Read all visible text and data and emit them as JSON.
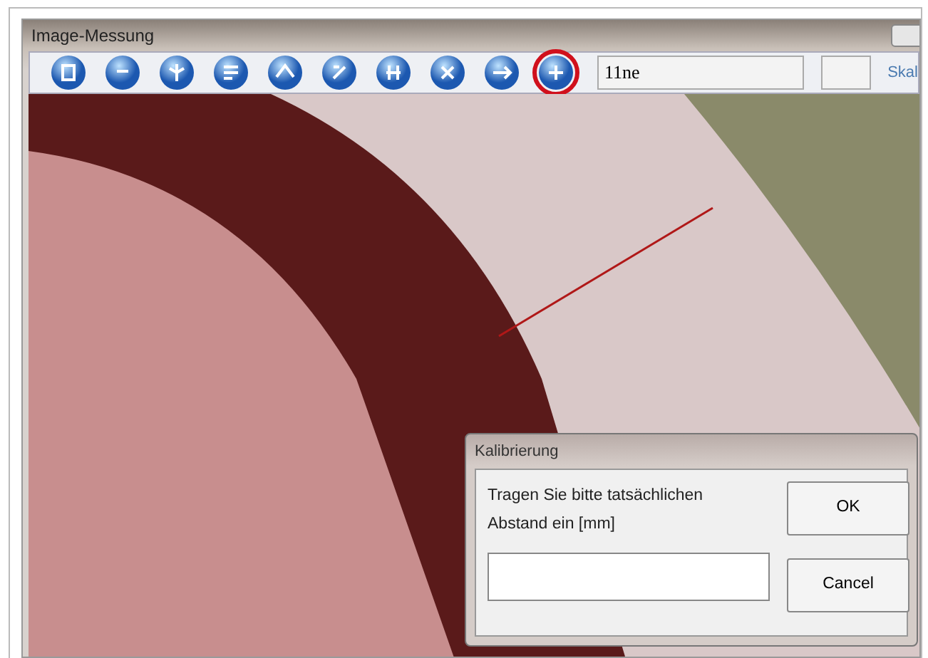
{
  "window": {
    "title": "Image-Messung"
  },
  "toolbar": {
    "buttons": [
      {
        "highlighted": false
      },
      {
        "highlighted": false
      },
      {
        "highlighted": false
      },
      {
        "highlighted": false
      },
      {
        "highlighted": false
      },
      {
        "highlighted": false
      },
      {
        "highlighted": false
      },
      {
        "highlighted": false
      },
      {
        "highlighted": false
      },
      {
        "highlighted": true
      }
    ],
    "line_field": {
      "value": "11ne"
    },
    "scale_label": "Skal"
  },
  "dialog": {
    "title": "Kalibrierung",
    "prompt": "Tragen Sie bitte tatsächlichen Abstand ein [mm]",
    "buttons": [
      "OK",
      "Cancel"
    ]
  }
}
